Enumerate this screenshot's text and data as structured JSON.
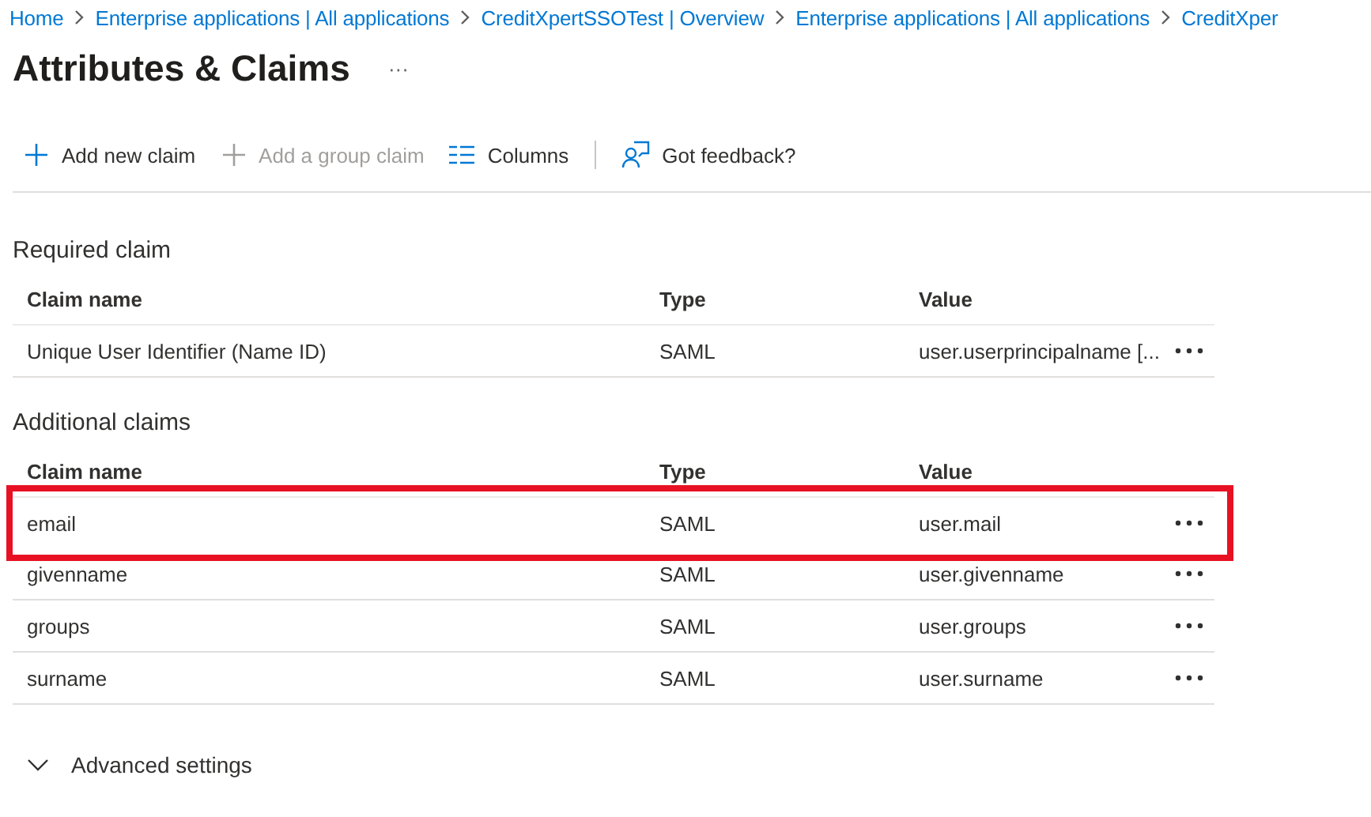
{
  "breadcrumb": [
    "Home",
    "Enterprise applications | All applications",
    "CreditXpertSSOTest | Overview",
    "Enterprise applications | All applications",
    "CreditXper"
  ],
  "title": "Attributes & Claims",
  "title_more": "···",
  "toolbar": [
    {
      "kind": "add",
      "label": "Add new claim",
      "disabled": false
    },
    {
      "kind": "add",
      "label": "Add a group claim",
      "disabled": true
    },
    {
      "kind": "columns",
      "label": "Columns",
      "disabled": false
    },
    {
      "kind": "feedback",
      "label": "Got feedback?",
      "disabled": false
    }
  ],
  "sections": [
    {
      "heading": "Required claim",
      "columns": [
        "Claim name",
        "Type",
        "Value"
      ],
      "rows": [
        {
          "name": "Unique User Identifier (Name ID)",
          "type": "SAML",
          "value": "user.userprincipalname [...",
          "highlighted": false
        }
      ]
    },
    {
      "heading": "Additional claims",
      "columns": [
        "Claim name",
        "Type",
        "Value"
      ],
      "rows": [
        {
          "name": "email",
          "type": "SAML",
          "value": "user.mail",
          "highlighted": true
        },
        {
          "name": "givenname",
          "type": "SAML",
          "value": "user.givenname",
          "highlighted": false
        },
        {
          "name": "groups",
          "type": "SAML",
          "value": "user.groups",
          "highlighted": false
        },
        {
          "name": "surname",
          "type": "SAML",
          "value": "user.surname",
          "highlighted": false
        }
      ]
    }
  ],
  "advanced": {
    "label": "Advanced settings",
    "expanded": false
  }
}
